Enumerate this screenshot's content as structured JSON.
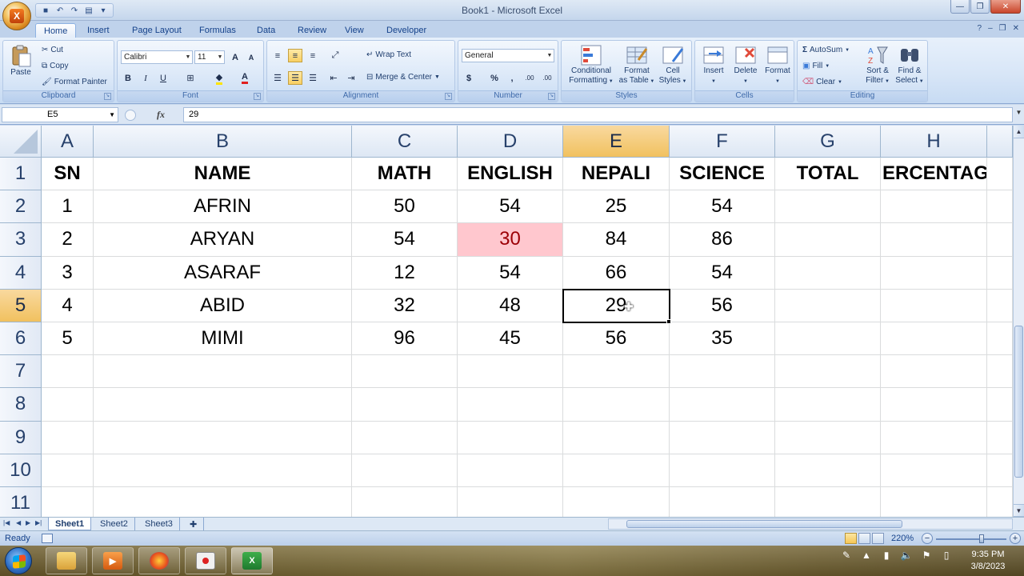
{
  "window": {
    "title": "Book1 - Microsoft Excel",
    "office_logo": "X",
    "controls": {
      "minimize": "—",
      "restore": "❐",
      "close": "✕"
    },
    "help_controls": {
      "help": "?",
      "minimize": "–",
      "restore": "❐",
      "close": "✕"
    }
  },
  "ribbon_tabs": [
    "Home",
    "Insert",
    "Page Layout",
    "Formulas",
    "Data",
    "Review",
    "View",
    "Developer"
  ],
  "ribbon": {
    "clipboard": {
      "label": "Clipboard",
      "paste": "Paste",
      "cut": "Cut",
      "copy": "Copy",
      "format_painter": "Format Painter"
    },
    "font": {
      "label": "Font",
      "name": "Calibri",
      "size": "11",
      "grow": "A",
      "shrink": "A",
      "bold": "B",
      "italic": "I",
      "underline": "U",
      "font_color_letter": "A"
    },
    "alignment": {
      "label": "Alignment",
      "wrap_text": "Wrap Text",
      "merge_center": "Merge & Center"
    },
    "number": {
      "label": "Number",
      "format": "General",
      "currency": "$",
      "percent": "%",
      "comma": ",",
      "inc_decimal": ".00",
      "dec_decimal": ".00"
    },
    "styles": {
      "label": "Styles",
      "conditional_1": "Conditional",
      "conditional_2": "Formatting",
      "format_table_1": "Format",
      "format_table_2": "as Table",
      "cell_styles_1": "Cell",
      "cell_styles_2": "Styles"
    },
    "cells": {
      "label": "Cells",
      "insert": "Insert",
      "delete": "Delete",
      "format": "Format"
    },
    "editing": {
      "label": "Editing",
      "autosum": "AutoSum",
      "fill": "Fill",
      "clear": "Clear",
      "sort_1": "Sort &",
      "sort_2": "Filter",
      "find_1": "Find &",
      "find_2": "Select"
    }
  },
  "formula_bar": {
    "name_box": "E5",
    "fx": "fx",
    "value": "29"
  },
  "columns": [
    "A",
    "B",
    "C",
    "D",
    "E",
    "F",
    "G",
    "H"
  ],
  "rows": [
    "1",
    "2",
    "3",
    "4",
    "5",
    "6",
    "7",
    "8",
    "9",
    "10",
    "11"
  ],
  "sheet": {
    "header": [
      "SN",
      "NAME",
      "MATH",
      "ENGLISH",
      "NEPALI",
      "SCIENCE",
      "TOTAL",
      "ERCENTAGE"
    ],
    "data": [
      [
        "1",
        "AFRIN",
        "50",
        "54",
        "25",
        "54",
        "",
        ""
      ],
      [
        "2",
        "ARYAN",
        "54",
        "30",
        "84",
        "86",
        "",
        ""
      ],
      [
        "3",
        "ASARAF",
        "12",
        "54",
        "66",
        "54",
        "",
        ""
      ],
      [
        "4",
        "ABID",
        "32",
        "48",
        "29",
        "56",
        "",
        ""
      ],
      [
        "5",
        "MIMI",
        "96",
        "45",
        "56",
        "35",
        "",
        ""
      ]
    ],
    "highlighted_cell": "D3",
    "highlight_color": "#ffc7ce",
    "highlight_text_color": "#9c0006",
    "active_cell": "E5"
  },
  "sheet_tabs": [
    "Sheet1",
    "Sheet2",
    "Sheet3"
  ],
  "nav_arrows": {
    "first": "|◀",
    "prev": "◀",
    "next": "▶",
    "last": "▶|"
  },
  "status": {
    "text": "Ready",
    "zoom": "220%",
    "zoom_minus": "−",
    "zoom_plus": "+"
  },
  "taskbar": {
    "clock_time": "9:35 PM",
    "clock_date": "3/8/2023",
    "apps": [
      "windows-explorer",
      "media-player",
      "firefox",
      "recorder",
      "excel"
    ]
  }
}
